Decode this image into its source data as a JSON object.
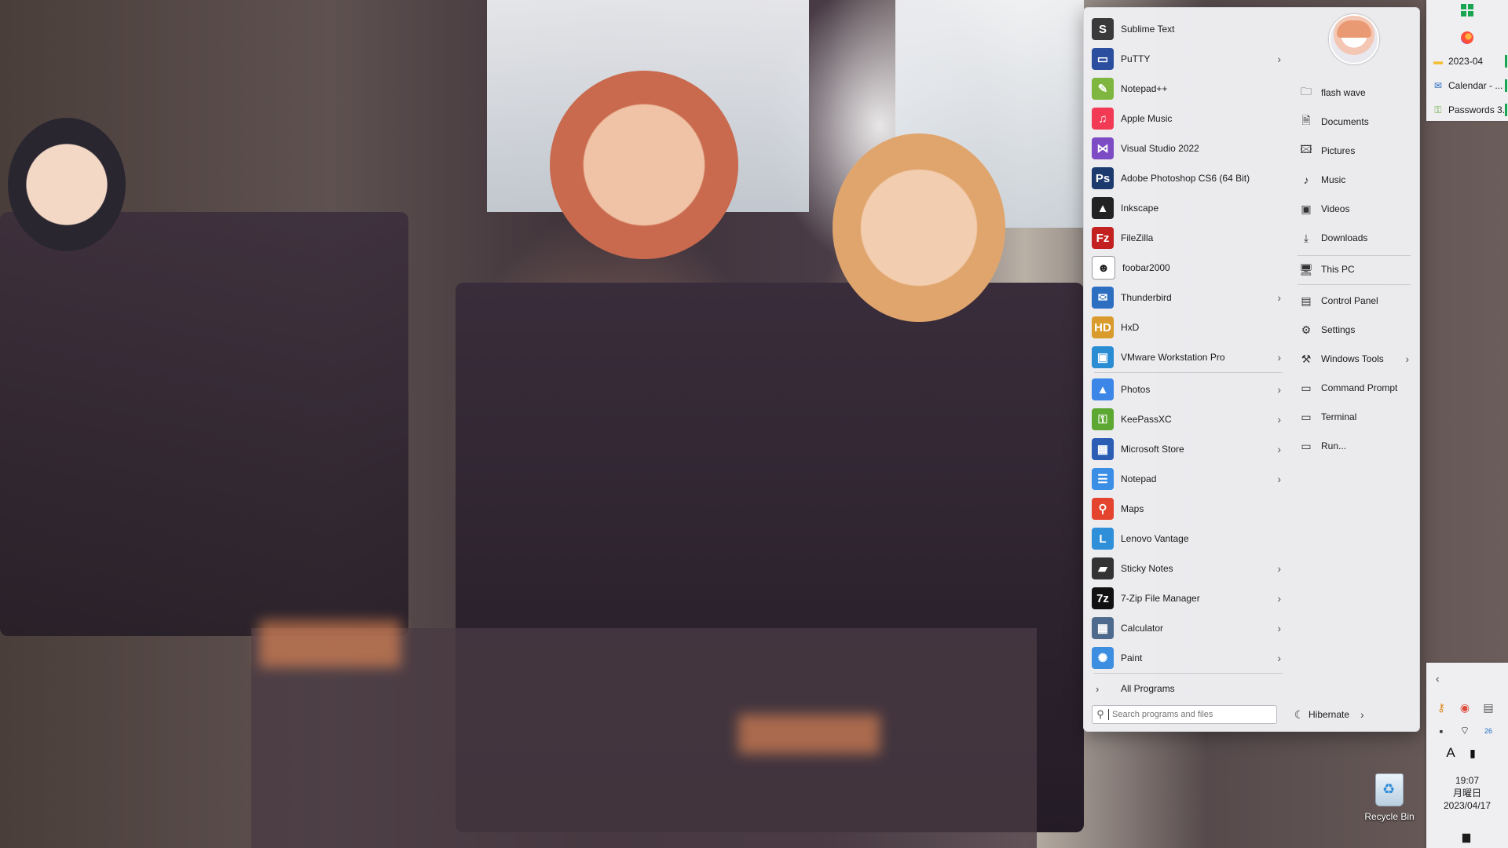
{
  "programs": [
    {
      "label": "Sublime Text",
      "icon": "sublime-text-icon",
      "glyph": "S",
      "color": "#3a3a3a",
      "submenu": false
    },
    {
      "label": "PuTTY",
      "icon": "putty-icon",
      "glyph": "▭",
      "color": "#2b4f9e",
      "submenu": true
    },
    {
      "label": "Notepad++",
      "icon": "notepadpp-icon",
      "glyph": "✎",
      "color": "#7fb640",
      "submenu": false
    },
    {
      "label": "Apple Music",
      "icon": "apple-music-icon",
      "glyph": "♫",
      "color": "#f33a55",
      "submenu": false
    },
    {
      "label": "Visual Studio 2022",
      "icon": "visual-studio-icon",
      "glyph": "⋈",
      "color": "#7d4bc4",
      "submenu": false
    },
    {
      "label": "Adobe Photoshop CS6 (64 Bit)",
      "icon": "photoshop-icon",
      "glyph": "Ps",
      "color": "#1c3a6e",
      "submenu": false
    },
    {
      "label": "Inkscape",
      "icon": "inkscape-icon",
      "glyph": "▲",
      "color": "#222222",
      "submenu": false
    },
    {
      "label": "FileZilla",
      "icon": "filezilla-icon",
      "glyph": "Fz",
      "color": "#c32020",
      "submenu": false
    },
    {
      "label": "foobar2000",
      "icon": "foobar-icon",
      "glyph": "☻",
      "color": "#ffffff",
      "submenu": false
    },
    {
      "label": "Thunderbird",
      "icon": "thunderbird-icon",
      "glyph": "✉",
      "color": "#2c6fc1",
      "submenu": true
    },
    {
      "label": "HxD",
      "icon": "hxd-icon",
      "glyph": "HD",
      "color": "#d99b2b",
      "submenu": false
    },
    {
      "label": "VMware Workstation Pro",
      "icon": "vmware-icon",
      "glyph": "▣",
      "color": "#2a8dd4",
      "submenu": true
    },
    {
      "label": "Photos",
      "icon": "photos-icon",
      "glyph": "▲",
      "color": "#3c86e8",
      "submenu": true
    },
    {
      "label": "KeePassXC",
      "icon": "keepassxc-icon",
      "glyph": "⚿",
      "color": "#5da832",
      "submenu": true
    },
    {
      "label": "Microsoft Store",
      "icon": "microsoft-store-icon",
      "glyph": "▦",
      "color": "#2b5db5",
      "submenu": true
    },
    {
      "label": "Notepad",
      "icon": "notepad-icon",
      "glyph": "☰",
      "color": "#3a8ee6",
      "submenu": true
    },
    {
      "label": "Maps",
      "icon": "maps-icon",
      "glyph": "⚲",
      "color": "#e4432d",
      "submenu": false
    },
    {
      "label": "Lenovo Vantage",
      "icon": "lenovo-vantage-icon",
      "glyph": "L",
      "color": "#2f8fd8",
      "submenu": false
    },
    {
      "label": "Sticky Notes",
      "icon": "sticky-notes-icon",
      "glyph": "▰",
      "color": "#333333",
      "submenu": true
    },
    {
      "label": "7-Zip File Manager",
      "icon": "7zip-icon",
      "glyph": "7z",
      "color": "#111111",
      "submenu": true
    },
    {
      "label": "Calculator",
      "icon": "calculator-icon",
      "glyph": "▦",
      "color": "#4e6a8c",
      "submenu": true
    },
    {
      "label": "Paint",
      "icon": "paint-icon",
      "glyph": "✺",
      "color": "#3d8de0",
      "submenu": true
    }
  ],
  "menu": {
    "all_programs": "All Programs",
    "search_placeholder": "Search programs and files",
    "hibernate": "Hibernate"
  },
  "places": [
    {
      "label": "flash wave",
      "icon": "user-folder-icon",
      "glyph": "🗀",
      "submenu": false
    },
    {
      "label": "Documents",
      "icon": "documents-icon",
      "glyph": "🗎",
      "submenu": false
    },
    {
      "label": "Pictures",
      "icon": "pictures-icon",
      "glyph": "🖾",
      "submenu": false
    },
    {
      "label": "Music",
      "icon": "music-icon",
      "glyph": "♪",
      "submenu": false
    },
    {
      "label": "Videos",
      "icon": "videos-icon",
      "glyph": "▣",
      "submenu": false
    },
    {
      "label": "Downloads",
      "icon": "downloads-icon",
      "glyph": "⤓",
      "submenu": false
    },
    {
      "label": "This PC",
      "icon": "this-pc-icon",
      "glyph": "🖥",
      "submenu": false
    },
    {
      "label": "Control Panel",
      "icon": "control-panel-icon",
      "glyph": "▤",
      "submenu": false
    },
    {
      "label": "Settings",
      "icon": "settings-icon",
      "glyph": "⚙",
      "submenu": false
    },
    {
      "label": "Windows Tools",
      "icon": "windows-tools-icon",
      "glyph": "⚒",
      "submenu": true
    },
    {
      "label": "Command Prompt",
      "icon": "command-prompt-icon",
      "glyph": "▭",
      "submenu": false
    },
    {
      "label": "Terminal",
      "icon": "terminal-icon",
      "glyph": "▭",
      "submenu": false
    },
    {
      "label": "Run...",
      "icon": "run-icon",
      "glyph": "▭",
      "submenu": false
    }
  ],
  "taskbar": {
    "tasks": [
      {
        "label": "2023-04",
        "icon": "folder-icon",
        "glyph": "▬",
        "color": "#f2c037"
      },
      {
        "label": "Calendar - ...",
        "icon": "thunderbird-icon",
        "glyph": "✉",
        "color": "#2c6fc1"
      },
      {
        "label": "Passwords 3...",
        "icon": "keepassxc-icon",
        "glyph": "⚿",
        "color": "#5da832"
      }
    ],
    "tray": [
      {
        "icon": "key-icon",
        "glyph": "⚷",
        "color": "#e08a1e"
      },
      {
        "icon": "chrome-icon",
        "glyph": "◉",
        "color": "#dd4b39"
      },
      {
        "icon": "drive-icon",
        "glyph": "▤",
        "color": "#555555"
      },
      {
        "icon": "camera-icon",
        "glyph": "▪",
        "color": "#333333"
      },
      {
        "icon": "wifi-icon",
        "glyph": "⌔",
        "color": "#222222"
      },
      {
        "icon": "battery-icon",
        "glyph": "26",
        "color": "#1b6ec2"
      },
      {
        "icon": "ime-icon",
        "glyph": "A",
        "color": "#111111"
      },
      {
        "icon": "keyboard-layout-icon",
        "glyph": "▮",
        "color": "#111111"
      }
    ],
    "clock": {
      "time": "19:07",
      "weekday": "月曜日",
      "date": "2023/04/17"
    }
  },
  "desktop": {
    "recycle_bin": "Recycle Bin"
  }
}
